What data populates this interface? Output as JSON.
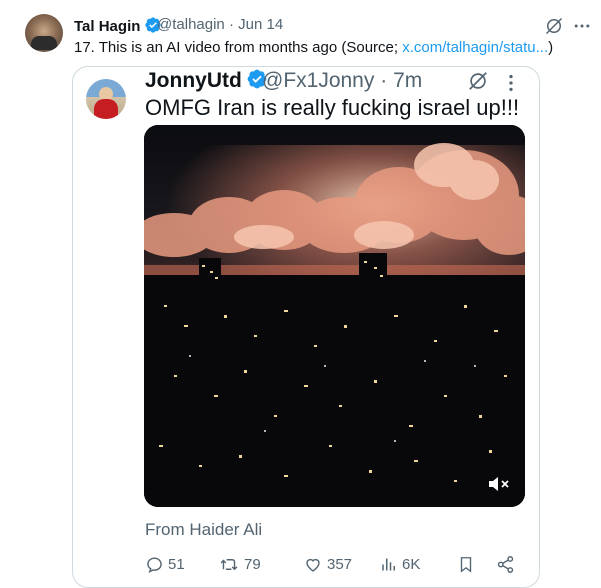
{
  "outer_tweet": {
    "author_name": "Tal Hagin",
    "handle": "@talhagin",
    "separator": "·",
    "date": "Jun 14",
    "text_prefix": "17. This is an AI video from months ago (Source; ",
    "link_text": "x.com/talhagin/statu...",
    "text_suffix": ")"
  },
  "quoted_tweet": {
    "author_name": "JonnyUtd",
    "handle": "@Fx1Jonny",
    "separator": "·",
    "time": "7m",
    "text": "OMFG Iran is really fucking israel up!!!",
    "attribution": "From Haider Ali"
  },
  "actions": {
    "replies": "51",
    "reposts": "79",
    "likes": "357",
    "views": "6K"
  },
  "colors": {
    "link": "#1d9bf0",
    "verified": "#1d9bf0",
    "muted_text": "#536471",
    "border": "#cfd9de"
  },
  "icons": [
    "verified-badge-icon",
    "grok-icon",
    "more-icon",
    "mute-icon",
    "reply-icon",
    "repost-icon",
    "like-icon",
    "views-icon",
    "bookmark-icon",
    "share-icon"
  ]
}
